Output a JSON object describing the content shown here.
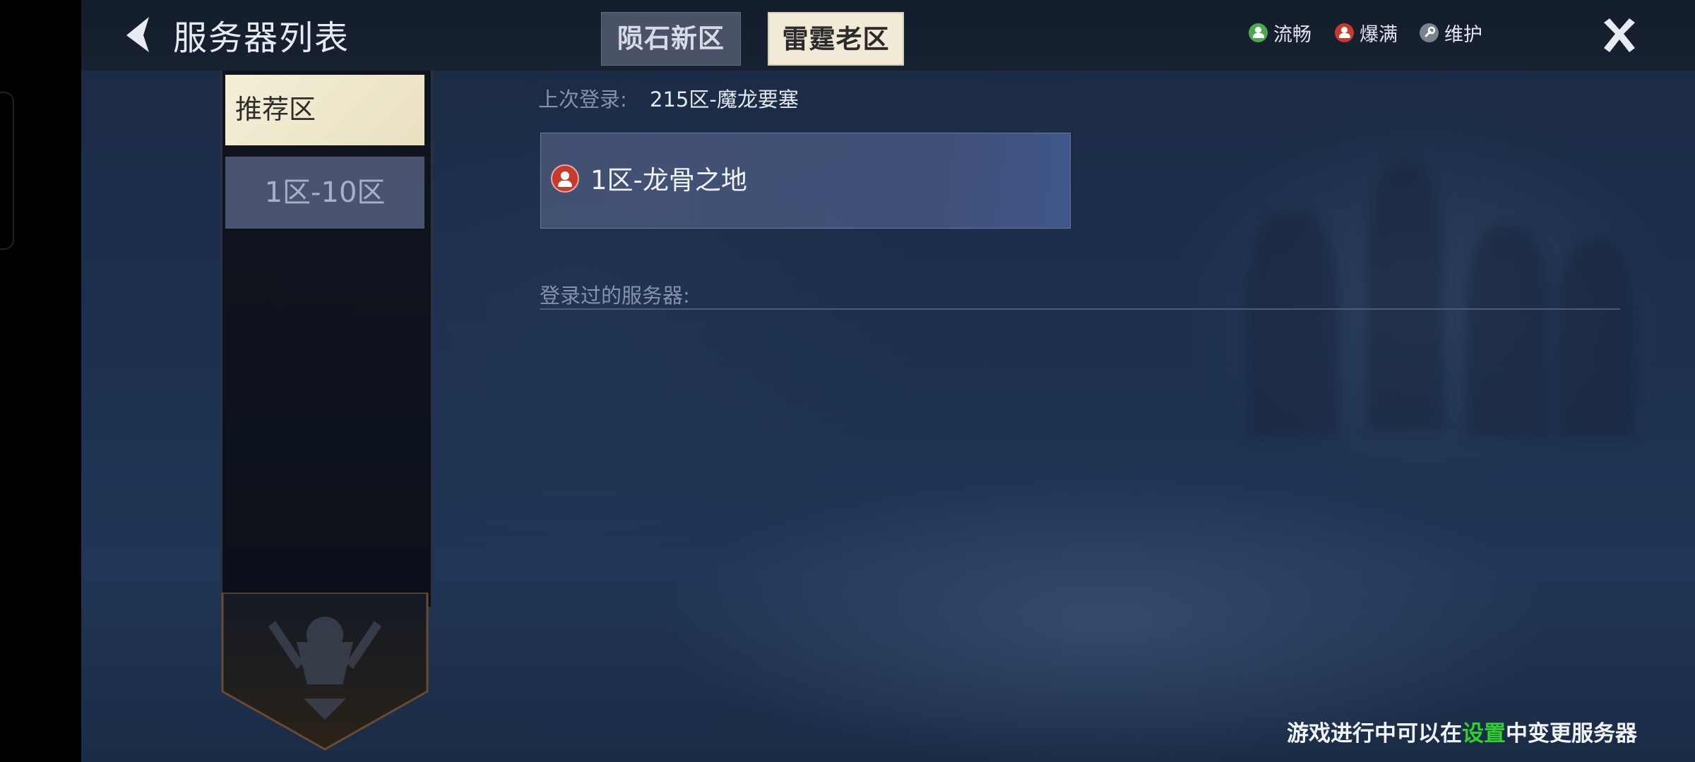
{
  "header": {
    "title": "服务器列表",
    "tabs": [
      {
        "label": "陨石新区",
        "selected": false
      },
      {
        "label": "雷霆老区",
        "selected": true
      }
    ],
    "legend": [
      {
        "label": "流畅",
        "icon": "person-icon",
        "color": "#4ea84e"
      },
      {
        "label": "爆满",
        "icon": "person-icon",
        "color": "#c8392e"
      },
      {
        "label": "维护",
        "icon": "wrench-icon",
        "color": "#7a8290"
      }
    ]
  },
  "sidebar": {
    "items": [
      {
        "label": "推荐区",
        "selected": true
      },
      {
        "label": "1区-10区",
        "selected": false
      }
    ]
  },
  "main": {
    "last_login_label": "上次登录:",
    "last_login_value": "215区-魔龙要塞",
    "server_card": {
      "name": "1区-龙骨之地",
      "status": "爆满",
      "status_color": "#c8392e"
    },
    "history_label": "登录过的服务器:"
  },
  "footer": {
    "hint_prefix": "游戏进行中可以在",
    "hint_link": "设置",
    "hint_suffix": "中变更服务器",
    "link_color": "#2fd12f"
  }
}
